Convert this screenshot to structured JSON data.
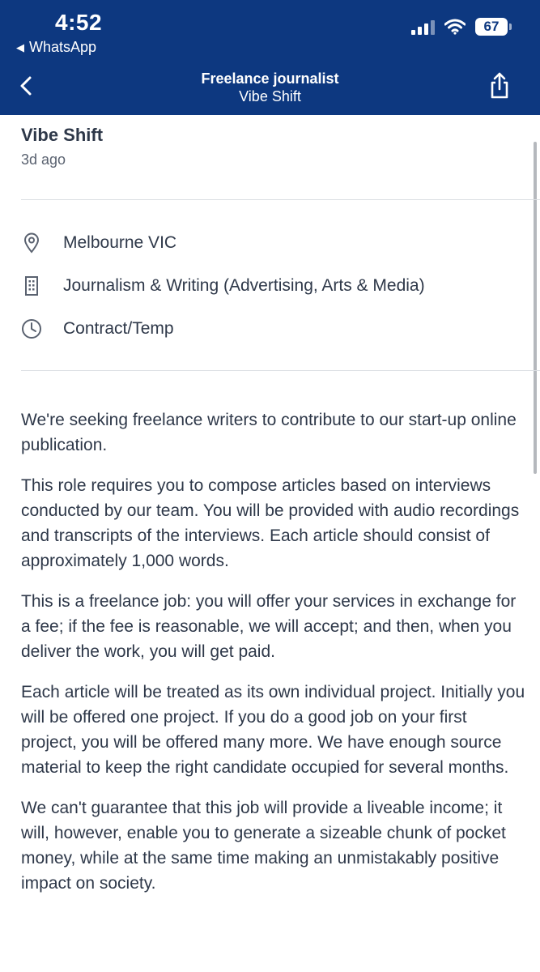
{
  "status_bar": {
    "time": "4:52",
    "back_app": "WhatsApp",
    "battery": "67"
  },
  "nav": {
    "title": "Freelance journalist",
    "subtitle": "Vibe Shift"
  },
  "job": {
    "company": "Vibe Shift",
    "posted": "3d ago",
    "location": "Melbourne VIC",
    "category": "Journalism & Writing (Advertising, Arts & Media)",
    "work_type": "Contract/Temp"
  },
  "description": [
    "We're seeking freelance writers to contribute to our start-up online publication.",
    "This role requires you to compose articles based on interviews conducted by our team. You will be provided with audio recordings and transcripts of the interviews. Each article should consist of approximately 1,000 words.",
    "This is a freelance job: you will offer your services in exchange for a fee; if the fee is reasonable, we will accept; and then, when you deliver the work, you will get paid.",
    "Each article will be treated as its own individual project. Initially you will be offered one project. If you do a good job on your first project, you will be offered many more. We have enough source material to keep the right candidate occupied for several months.",
    "We can't guarantee that this job will provide a liveable income; it will, however, enable you to generate a sizeable chunk of pocket money, while at the same time making an unmistakably positive impact on society."
  ],
  "colors": {
    "header_bg": "#0d3880",
    "text": "#2e3849",
    "muted": "#5a6270"
  },
  "icons": [
    "location-pin-icon",
    "building-icon",
    "clock-icon",
    "back-chevron-icon",
    "share-icon",
    "wifi-icon",
    "signal-icon"
  ]
}
